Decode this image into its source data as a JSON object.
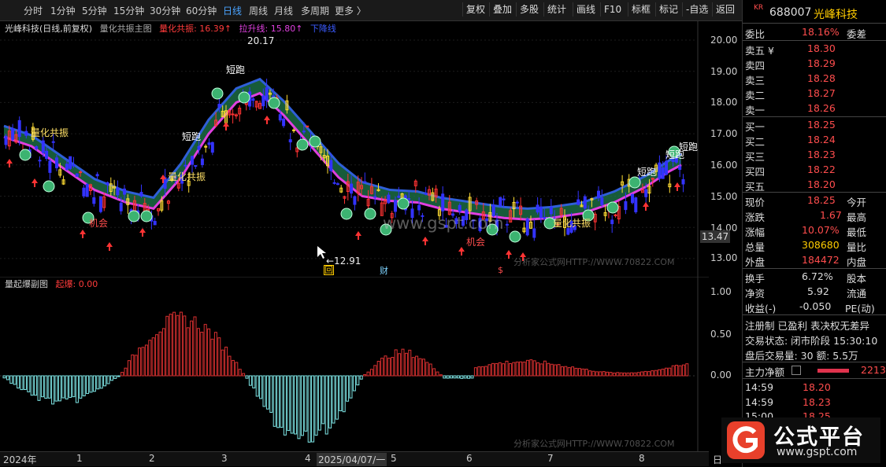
{
  "toolbar": {
    "periods": [
      "分时",
      "1分钟",
      "5分钟",
      "15分钟",
      "30分钟",
      "60分钟",
      "日线",
      "周线",
      "月线",
      "多周期",
      "更多 〉"
    ],
    "active_period": "日线",
    "buttons": [
      "复权",
      "叠加",
      "多股",
      "统计",
      "画线",
      "F10",
      "标框",
      "标记",
      "-自选",
      "返回"
    ]
  },
  "main_legend": {
    "stock": "光峰科技(日线,前复权)",
    "indicator_name": "量化共振主图",
    "line1_label": "量化共振: 16.39↑",
    "line2_label": "拉升线: 15.80↑",
    "line3_label": "下降线"
  },
  "sub_legend": {
    "indicator_name": "量起爆副图",
    "value_label": "起爆: 0.00"
  },
  "colors": {
    "up": "#ff3333",
    "down": "#3333ff",
    "band_up": "#b33c3c",
    "band_down": "#1f7a4d",
    "line_magenta": "#e040e0",
    "line_blue": "#2f5fd8",
    "hist_pos": "#d93030",
    "hist_neg": "#7ee6e6"
  },
  "main_y_ticks": [
    "20.00",
    "19.00",
    "18.00",
    "17.00",
    "16.00",
    "15.00",
    "14.00",
    "13.00"
  ],
  "price_cursor": "13.47",
  "sub_y_ticks": [
    "1.00",
    "0.50",
    "0.00"
  ],
  "annotations": {
    "high": "20.17",
    "low": "←12.91",
    "signals": [
      "量化共振",
      "量化共振",
      "量化共振",
      "短跑",
      "短跑",
      "短跑",
      "短跑",
      "机会",
      "机会",
      "短跑"
    ],
    "markers": [
      "回",
      "财",
      "$"
    ],
    "watermark_site": "www.gspt.com",
    "watermark_text": "分析家公式网HTTP://WWW.70822.COM"
  },
  "x_axis": [
    "2024年",
    "1",
    "2",
    "3",
    "4",
    "2025/04/07/一",
    "5",
    "6",
    "7",
    "8",
    "日"
  ],
  "right_panel": {
    "code": "688007",
    "name": "光峰科技",
    "badge": "KR",
    "webi_label": "委比",
    "webi_value": "18.16%",
    "weicha_label": "委差",
    "asks": [
      {
        "label": "卖五 ¥",
        "price": "18.30"
      },
      {
        "label": "卖四",
        "price": "18.29"
      },
      {
        "label": "卖三",
        "price": "18.28"
      },
      {
        "label": "卖二",
        "price": "18.27"
      },
      {
        "label": "卖一",
        "price": "18.26"
      }
    ],
    "bids": [
      {
        "label": "买一",
        "price": "18.25"
      },
      {
        "label": "买二",
        "price": "18.24"
      },
      {
        "label": "买三",
        "price": "18.23"
      },
      {
        "label": "买四",
        "price": "18.22"
      },
      {
        "label": "买五",
        "price": "18.20"
      }
    ],
    "quote": [
      {
        "l1": "现价",
        "v1": "18.25",
        "l2": "今开"
      },
      {
        "l1": "涨跌",
        "v1": "1.67",
        "l2": "最高"
      },
      {
        "l1": "涨幅",
        "v1": "10.07%",
        "l2": "最低"
      },
      {
        "l1": "总量",
        "v1": "308680",
        "l2": "量比"
      },
      {
        "l1": "外盘",
        "v1": "184472",
        "l2": "内盘"
      }
    ],
    "fund": [
      {
        "l1": "换手",
        "v1": "6.72%",
        "l2": "股本"
      },
      {
        "l1": "净资",
        "v1": "5.92",
        "l2": "流通"
      },
      {
        "l1": "收益(-)",
        "v1": "-0.050",
        "l2": "PE(动)"
      }
    ],
    "tags": "注册制 已盈利 表决权无差异",
    "trade_status": "交易状态: 闭市阶段 15:30:10",
    "after_trade": "盘后交易量: 30  额: 5.5万",
    "main_flow_label": "主力净额",
    "main_flow_value": "2213",
    "ticks": [
      {
        "time": "14:59",
        "price": "18.20"
      },
      {
        "time": "14:59",
        "price": "18.23"
      },
      {
        "time": "15:00",
        "price": "18.25"
      }
    ]
  },
  "logo": {
    "text": "公式平台",
    "url": "www.gspt.com"
  }
}
